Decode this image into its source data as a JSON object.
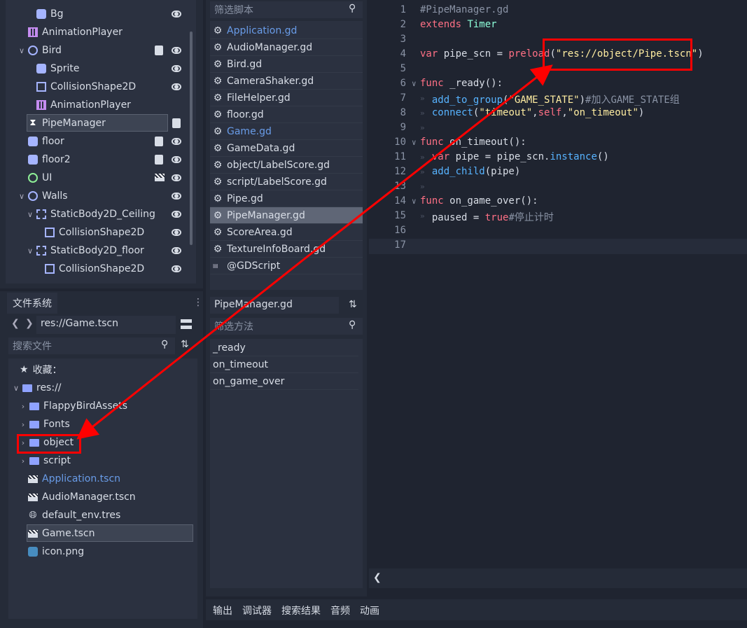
{
  "scene_tree": {
    "items": [
      {
        "label": "Bg",
        "icon": "sprite-icon"
      },
      {
        "label": "AnimationPlayer",
        "icon": "animation-player-icon"
      },
      {
        "label": "Bird",
        "icon": "rigidbody-icon"
      },
      {
        "label": "Sprite",
        "icon": "sprite-icon"
      },
      {
        "label": "CollisionShape2D",
        "icon": "collision-shape-icon"
      },
      {
        "label": "AnimationPlayer",
        "icon": "animation-player-icon"
      },
      {
        "label": "PipeManager",
        "icon": "timer-icon"
      },
      {
        "label": "floor",
        "icon": "sprite-icon"
      },
      {
        "label": "floor2",
        "icon": "sprite-icon"
      },
      {
        "label": "UI",
        "icon": "control-icon"
      },
      {
        "label": "Walls",
        "icon": "node2d-icon"
      },
      {
        "label": "StaticBody2D_Ceiling",
        "icon": "static-body-icon"
      },
      {
        "label": "CollisionShape2D",
        "icon": "collision-shape-icon"
      },
      {
        "label": "StaticBody2D_floor",
        "icon": "static-body-icon"
      },
      {
        "label": "CollisionShape2D",
        "icon": "collision-shape-icon"
      }
    ]
  },
  "filesystem": {
    "tab_label": "文件系统",
    "path": "res://Game.tscn",
    "search_placeholder": "搜索文件",
    "favorites_label": "收藏：",
    "root_label": "res://",
    "items": [
      {
        "label": "FlappyBirdAssets",
        "type": "folder"
      },
      {
        "label": "Fonts",
        "type": "folder"
      },
      {
        "label": "object",
        "type": "folder"
      },
      {
        "label": "script",
        "type": "folder"
      },
      {
        "label": "Application.tscn",
        "type": "scene"
      },
      {
        "label": "AudioManager.tscn",
        "type": "scene"
      },
      {
        "label": "default_env.tres",
        "type": "resource"
      },
      {
        "label": "Game.tscn",
        "type": "scene"
      },
      {
        "label": "icon.png",
        "type": "image"
      }
    ]
  },
  "scripts": {
    "filter_placeholder": "筛选脚本",
    "items": [
      "Application.gd",
      "AudioManager.gd",
      "Bird.gd",
      "CameraShaker.gd",
      "FileHelper.gd",
      "floor.gd",
      "Game.gd",
      "GameData.gd",
      "object/LabelScore.gd",
      "script/LabelScore.gd",
      "Pipe.gd",
      "PipeManager.gd",
      "ScoreArea.gd",
      "TextureInfoBoard.gd",
      "@GDScript"
    ],
    "current_file": "PipeManager.gd",
    "method_filter_placeholder": "筛选方法",
    "methods": [
      "_ready",
      "on_timeout",
      "on_game_over"
    ]
  },
  "editor": {
    "line_numbers": [
      "1",
      "2",
      "3",
      "4",
      "5",
      "6",
      "7",
      "8",
      "9",
      "10",
      "11",
      "12",
      "13",
      "14",
      "15",
      "16",
      "17"
    ],
    "l1": "#PipeManager.gd",
    "l2_kw": "extends",
    "l2_ty": "Timer",
    "l4_kw": "var",
    "l4_a": " pipe_scn = ",
    "l4_fn": "preload",
    "l4_p1": "(",
    "l4_str": "\"res://object/Pipe.tscn\"",
    "l4_p2": ")",
    "l6_kw": "func",
    "l6_a": " _ready():",
    "l7_fn": "add_to_group",
    "l7_p1": "(",
    "l7_str": "\"GAME_STATE\"",
    "l7_p2": ")",
    "l7_cm": "#加入GAME_STATE组",
    "l8_fn": "connect",
    "l8_p1": "(",
    "l8_str1": "\"timeout\"",
    "l8_c1": ",",
    "l8_kw": "self",
    "l8_c2": ",",
    "l8_str2": "\"on_timeout\"",
    "l8_p2": ")",
    "l10_kw": "func",
    "l10_a": " on_timeout():",
    "l11_kw": "var",
    "l11_a": " pipe = pipe_scn.",
    "l11_mem": "instance",
    "l11_b": "()",
    "l12_fn": "add_child",
    "l12_a": "(pipe)",
    "l14_kw": "func",
    "l14_a": " on_game_over():",
    "l15_a": "paused = ",
    "l15_kw": "true",
    "l15_cm": "#停止计时"
  },
  "bottom_tabs": [
    "输出",
    "调试器",
    "搜索结果",
    "音频",
    "动画"
  ],
  "colors": {
    "accent": "#699ce8",
    "annotation": "#ff0000",
    "keyword": "#ff7085",
    "string": "#ffeda1"
  }
}
